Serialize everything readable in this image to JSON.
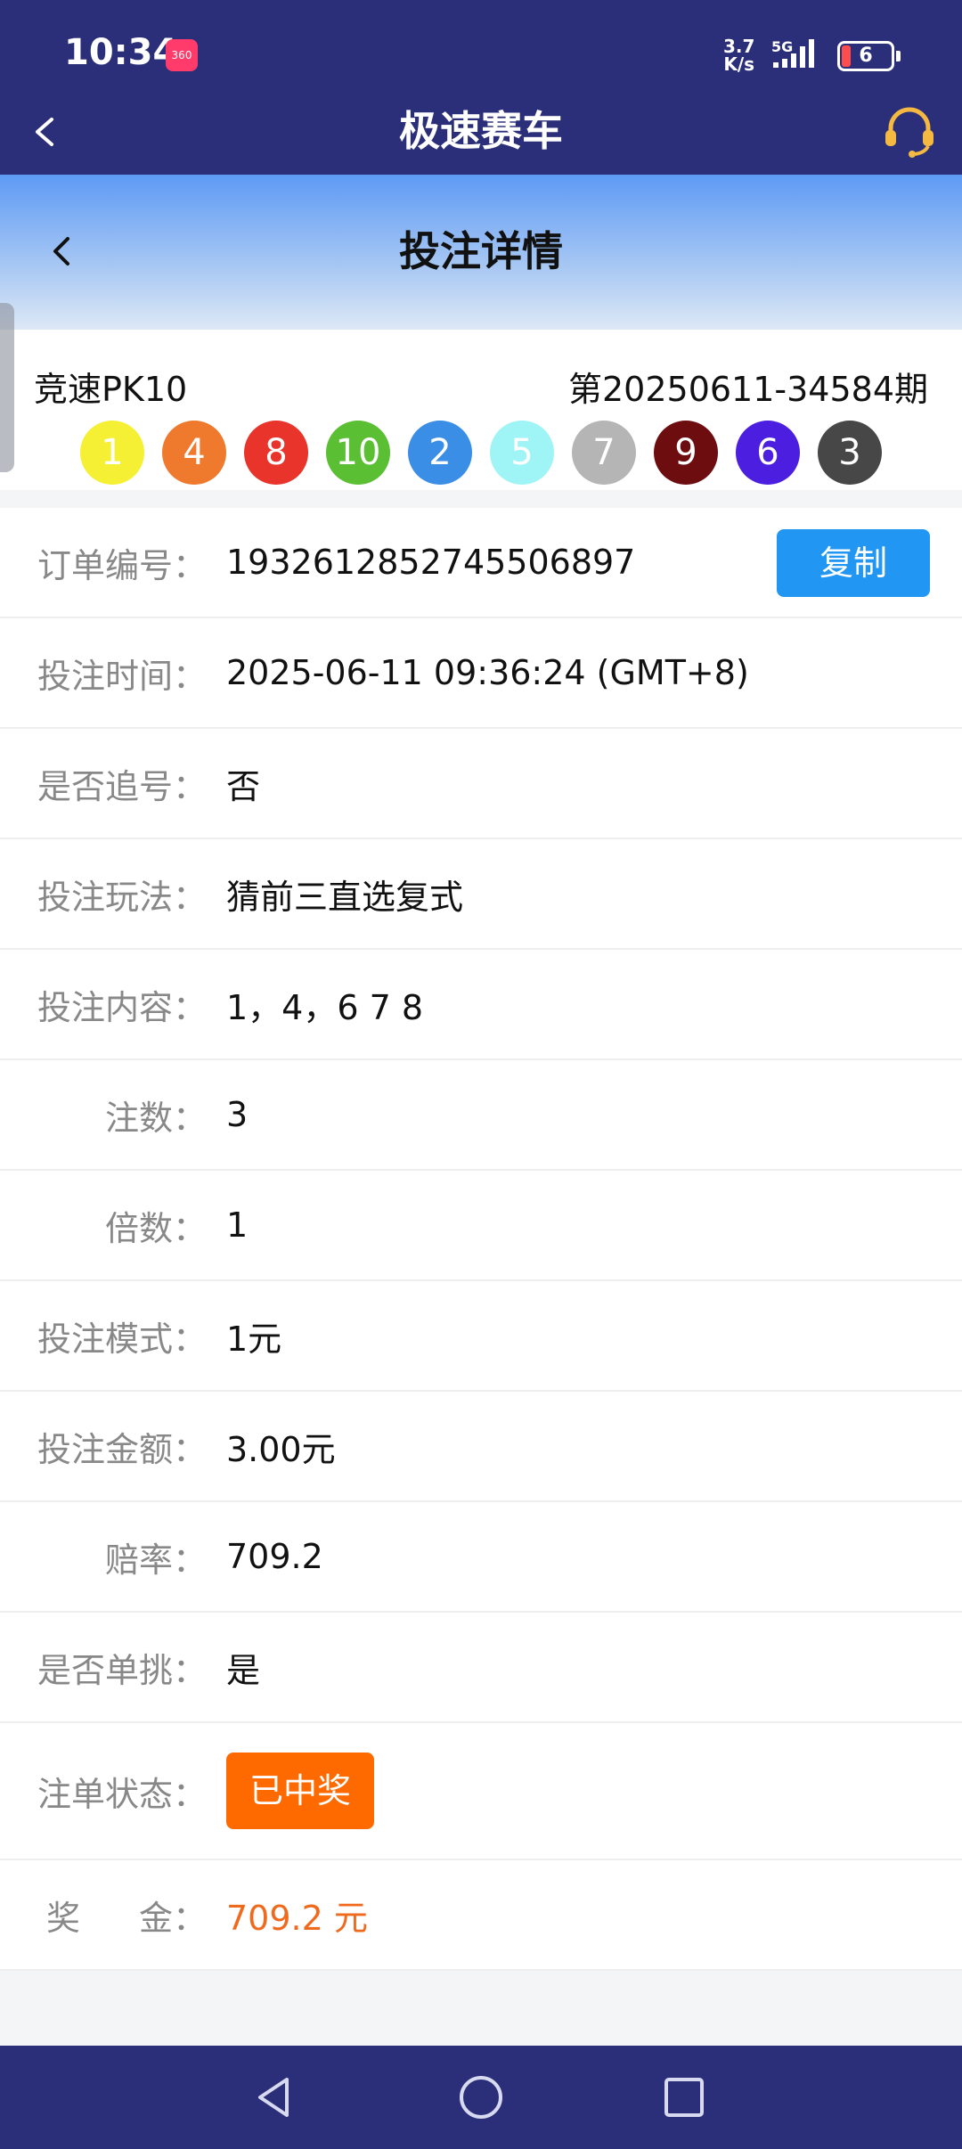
{
  "status_bar": {
    "time": "10:34",
    "app_badge": "360",
    "net_speed_value": "3.7",
    "net_speed_unit": "K/s",
    "network": "5G",
    "battery": "6",
    "battery_color": "#ff4d4d"
  },
  "app_header": {
    "title": "极速赛车",
    "back_icon": "chevron-left-icon",
    "support_icon": "headset-icon"
  },
  "sub_header": {
    "title": "投注详情",
    "back_icon": "chevron-left-icon"
  },
  "draw": {
    "game_name": "竞速PK10",
    "issue": "第20250611-34584期",
    "balls": [
      {
        "number": "1",
        "color": "#f5f033",
        "text_color": "#ffffff"
      },
      {
        "number": "4",
        "color": "#ef7a2e",
        "text_color": "#ffffff"
      },
      {
        "number": "8",
        "color": "#e8342b",
        "text_color": "#ffffff"
      },
      {
        "number": "10",
        "color": "#5bbf34",
        "text_color": "#ffffff"
      },
      {
        "number": "2",
        "color": "#3b8ee6",
        "text_color": "#ffffff"
      },
      {
        "number": "5",
        "color": "#9ff5f5",
        "text_color": "#ffffff"
      },
      {
        "number": "7",
        "color": "#b5b5b5",
        "text_color": "#ffffff"
      },
      {
        "number": "9",
        "color": "#6e0d10",
        "text_color": "#ffffff"
      },
      {
        "number": "6",
        "color": "#4b1ee0",
        "text_color": "#ffffff"
      },
      {
        "number": "3",
        "color": "#474747",
        "text_color": "#ffffff"
      }
    ]
  },
  "details": {
    "order_no": {
      "label": "订单编号：",
      "value": "1932612852745506897",
      "copy_label": "复制"
    },
    "bet_time": {
      "label": "投注时间：",
      "value": "2025-06-11 09:36:24 (GMT+8)"
    },
    "chase": {
      "label": "是否追号：",
      "value": "否"
    },
    "play_type": {
      "label": "投注玩法：",
      "value": "猜前三直选复式"
    },
    "content": {
      "label": "投注内容：",
      "value": "1，4，6 7 8"
    },
    "bet_count": {
      "label": "注数：",
      "value": "3"
    },
    "multiplier": {
      "label": "倍数：",
      "value": "1"
    },
    "mode": {
      "label": "投注模式：",
      "value": "1元"
    },
    "amount": {
      "label": "投注金额：",
      "value": "3.00元"
    },
    "odds": {
      "label": "赔率：",
      "value": "709.2"
    },
    "single": {
      "label": "是否单挑：",
      "value": "是"
    },
    "status": {
      "label": "注单状态：",
      "value": "已中奖",
      "color": "#ff6a00"
    },
    "prize": {
      "label_a": "奖",
      "label_b": "金：",
      "value": "709.2 元",
      "color": "#f06a1e"
    }
  },
  "nav_bar": {
    "back_icon": "triangle-back-icon",
    "home_icon": "circle-home-icon",
    "recents_icon": "square-recents-icon"
  },
  "colors": {
    "header_bg": "#2b2f7a",
    "accent_blue": "#2196f3"
  }
}
